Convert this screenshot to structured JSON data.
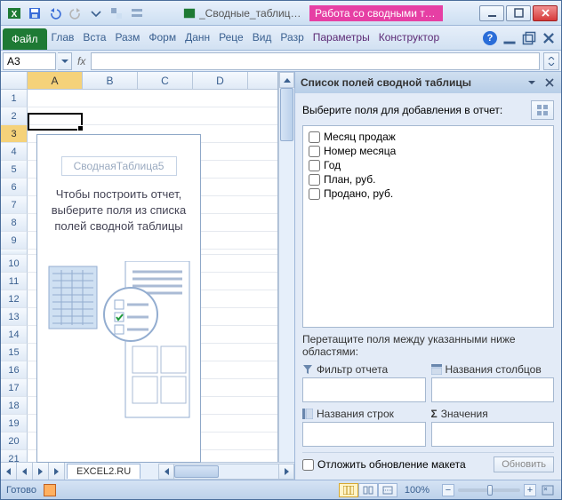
{
  "titlebar": {
    "doc": "_Сводные_таблицы._В…",
    "context": "Работа со сводными та…"
  },
  "ribbon": {
    "file": "Файл",
    "tabs": [
      "Глав",
      "Вста",
      "Разм",
      "Форм",
      "Данн",
      "Реце",
      "Вид",
      "Разр"
    ],
    "contextTabs": [
      "Параметры",
      "Конструктор"
    ]
  },
  "namebox": {
    "value": "A3"
  },
  "fx": {
    "label": "fx"
  },
  "columns": [
    "A",
    "B",
    "C",
    "D"
  ],
  "rows": [
    "1",
    "2",
    "3",
    "4",
    "5",
    "6",
    "7",
    "8",
    "9",
    "10",
    "11",
    "12",
    "13",
    "14",
    "15",
    "16",
    "17",
    "18",
    "19",
    "20",
    "21"
  ],
  "activeColumn": "A",
  "activeRow": "3",
  "pivotPlaceholder": {
    "title": "СводнаяТаблица5",
    "line1": "Чтобы построить отчет,",
    "line2": "выберите поля из списка",
    "line3": "полей сводной таблицы"
  },
  "fieldList": {
    "title": "Список полей сводной таблицы",
    "selectLabel": "Выберите поля для добавления в отчет:",
    "fields": [
      "Месяц продаж",
      "Номер месяца",
      "Год",
      "План, руб.",
      "Продано, руб."
    ],
    "dragLabel1": "Перетащите поля между указанными ниже",
    "dragLabel2": "областями:",
    "areaFilter": "Фильтр отчета",
    "areaColumns": "Названия столбцов",
    "areaRows": "Названия строк",
    "areaValues": "Значения",
    "deferLabel": "Отложить обновление макета",
    "updateBtn": "Обновить"
  },
  "sheetTab": "EXCEL2.RU",
  "status": {
    "ready": "Готово",
    "zoom": "100%"
  }
}
